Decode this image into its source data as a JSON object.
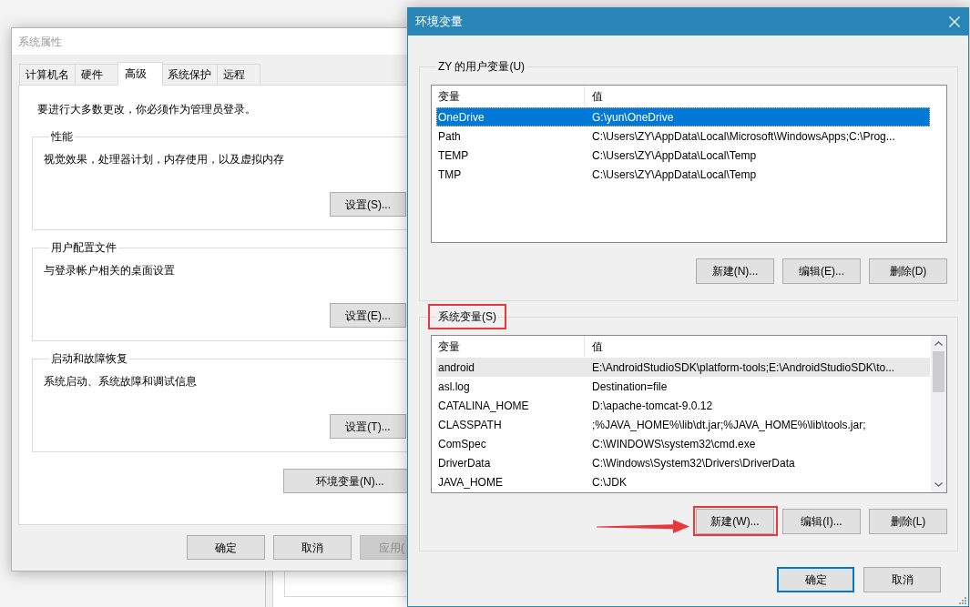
{
  "system_properties": {
    "title": "系统属性",
    "active": false,
    "tabs": [
      {
        "label": "计算机名",
        "selected": false
      },
      {
        "label": "硬件",
        "selected": false
      },
      {
        "label": "高级",
        "selected": true
      },
      {
        "label": "系统保护",
        "selected": false
      },
      {
        "label": "远程",
        "selected": false
      }
    ],
    "notice": "要进行大多数更改，你必须作为管理员登录。",
    "groups": [
      {
        "label": "性能",
        "description": "视觉效果，处理器计划，内存使用，以及虚拟内存",
        "button": "设置(S)..."
      },
      {
        "label": "用户配置文件",
        "description": "与登录帐户相关的桌面设置",
        "button": "设置(E)..."
      },
      {
        "label": "启动和故障恢复",
        "description": "系统启动、系统故障和调试信息",
        "button": "设置(T)..."
      }
    ],
    "environment_button": "环境变量(N)...",
    "buttons": [
      {
        "label": "确定",
        "disabled": false
      },
      {
        "label": "取消",
        "disabled": false
      },
      {
        "label": "应用(",
        "disabled": true
      }
    ]
  },
  "environment_variables": {
    "title": "环境变量",
    "active": true,
    "groups": [
      {
        "label": "ZY 的用户变量(U)",
        "highlighted": false,
        "focused": true,
        "scrollable": false,
        "columns": [
          "变量",
          "值"
        ],
        "rows": [
          {
            "name": "OneDrive",
            "value": "G:\\yun\\OneDrive",
            "selected": true
          },
          {
            "name": "Path",
            "value": "C:\\Users\\ZY\\AppData\\Local\\Microsoft\\WindowsApps;C:\\Prog...",
            "selected": false
          },
          {
            "name": "TEMP",
            "value": "C:\\Users\\ZY\\AppData\\Local\\Temp",
            "selected": false
          },
          {
            "name": "TMP",
            "value": "C:\\Users\\ZY\\AppData\\Local\\Temp",
            "selected": false
          }
        ],
        "buttons": [
          {
            "label": "新建(N)...",
            "highlighted": false
          },
          {
            "label": "编辑(E)...",
            "highlighted": false
          },
          {
            "label": "删除(D)",
            "highlighted": false
          }
        ]
      },
      {
        "label": "系统变量(S)",
        "highlighted": true,
        "focused": false,
        "scrollable": true,
        "columns": [
          "变量",
          "值"
        ],
        "rows": [
          {
            "name": "android",
            "value": "E:\\AndroidStudioSDK\\platform-tools;E:\\AndroidStudioSDK\\to...",
            "selected": true
          },
          {
            "name": "asl.log",
            "value": "Destination=file",
            "selected": false
          },
          {
            "name": "CATALINA_HOME",
            "value": "D:\\apache-tomcat-9.0.12",
            "selected": false
          },
          {
            "name": "CLASSPATH",
            "value": ";%JAVA_HOME%\\lib\\dt.jar;%JAVA_HOME%\\lib\\tools.jar;",
            "selected": false
          },
          {
            "name": "ComSpec",
            "value": "C:\\WINDOWS\\system32\\cmd.exe",
            "selected": false
          },
          {
            "name": "DriverData",
            "value": "C:\\Windows\\System32\\Drivers\\DriverData",
            "selected": false
          },
          {
            "name": "JAVA_HOME",
            "value": "C:\\JDK",
            "selected": false
          }
        ],
        "buttons": [
          {
            "label": "新建(W)...",
            "highlighted": true
          },
          {
            "label": "编辑(I)...",
            "highlighted": false
          },
          {
            "label": "删除(L)",
            "highlighted": false
          }
        ]
      }
    ],
    "buttons": [
      {
        "label": "确定",
        "default": true
      },
      {
        "label": "取消",
        "default": false
      }
    ]
  }
}
